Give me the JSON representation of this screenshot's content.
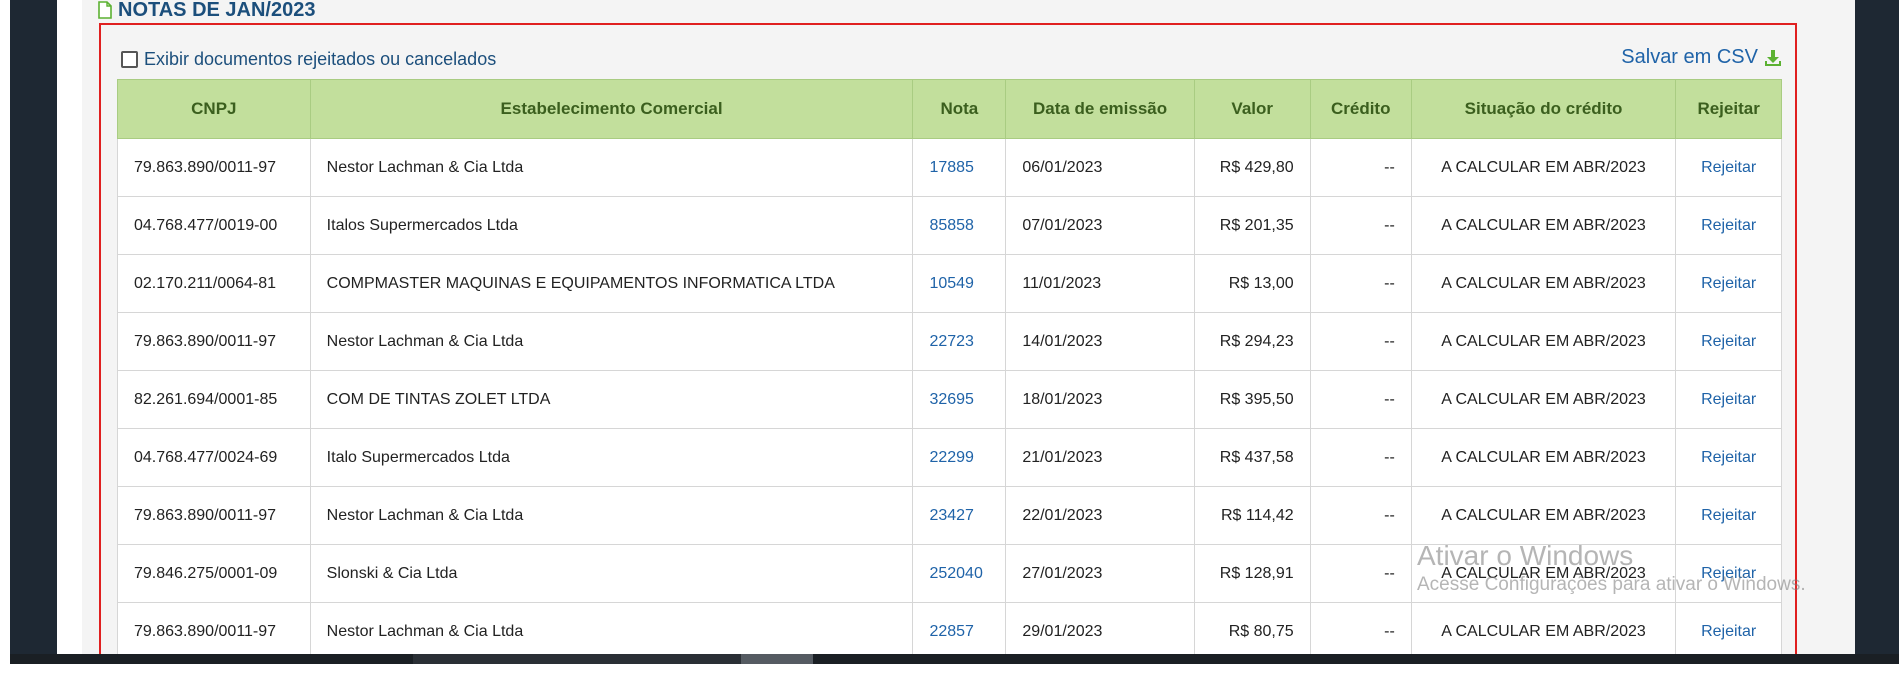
{
  "section": {
    "title": "NOTAS DE JAN/2023"
  },
  "toolbar": {
    "checkbox_label": "Exibir documentos rejeitados ou cancelados",
    "csv_label": "Salvar em CSV"
  },
  "table": {
    "headers": [
      "CNPJ",
      "Estabelecimento Comercial",
      "Nota",
      "Data de emissão",
      "Valor",
      "Crédito",
      "Situação do crédito",
      "Rejeitar"
    ],
    "rows": [
      {
        "cnpj": "79.863.890/0011-97",
        "estab": "Nestor Lachman & Cia Ltda",
        "nota": "17885",
        "data": "06/01/2023",
        "valor": "R$ 429,80",
        "credito": "--",
        "situacao": "A CALCULAR EM ABR/2023",
        "rejeitar": "Rejeitar"
      },
      {
        "cnpj": "04.768.477/0019-00",
        "estab": "Italos Supermercados Ltda",
        "nota": "85858",
        "data": "07/01/2023",
        "valor": "R$ 201,35",
        "credito": "--",
        "situacao": "A CALCULAR EM ABR/2023",
        "rejeitar": "Rejeitar"
      },
      {
        "cnpj": "02.170.211/0064-81",
        "estab": "COMPMASTER MAQUINAS E EQUIPAMENTOS INFORMATICA LTDA",
        "nota": "10549",
        "data": "11/01/2023",
        "valor": "R$ 13,00",
        "credito": "--",
        "situacao": "A CALCULAR EM ABR/2023",
        "rejeitar": "Rejeitar"
      },
      {
        "cnpj": "79.863.890/0011-97",
        "estab": "Nestor Lachman & Cia Ltda",
        "nota": "22723",
        "data": "14/01/2023",
        "valor": "R$ 294,23",
        "credito": "--",
        "situacao": "A CALCULAR EM ABR/2023",
        "rejeitar": "Rejeitar"
      },
      {
        "cnpj": "82.261.694/0001-85",
        "estab": "COM DE TINTAS ZOLET LTDA",
        "nota": "32695",
        "data": "18/01/2023",
        "valor": "R$ 395,50",
        "credito": "--",
        "situacao": "A CALCULAR EM ABR/2023",
        "rejeitar": "Rejeitar"
      },
      {
        "cnpj": "04.768.477/0024-69",
        "estab": "Italo Supermercados Ltda",
        "nota": "22299",
        "data": "21/01/2023",
        "valor": "R$ 437,58",
        "credito": "--",
        "situacao": "A CALCULAR EM ABR/2023",
        "rejeitar": "Rejeitar"
      },
      {
        "cnpj": "79.863.890/0011-97",
        "estab": "Nestor Lachman & Cia Ltda",
        "nota": "23427",
        "data": "22/01/2023",
        "valor": "R$ 114,42",
        "credito": "--",
        "situacao": "A CALCULAR EM ABR/2023",
        "rejeitar": "Rejeitar"
      },
      {
        "cnpj": "79.846.275/0001-09",
        "estab": "Slonski & Cia Ltda",
        "nota": "252040",
        "data": "27/01/2023",
        "valor": "R$ 128,91",
        "credito": "--",
        "situacao": "A CALCULAR EM ABR/2023",
        "rejeitar": "Rejeitar"
      },
      {
        "cnpj": "79.863.890/0011-97",
        "estab": "Nestor Lachman & Cia Ltda",
        "nota": "22857",
        "data": "29/01/2023",
        "valor": "R$ 80,75",
        "credito": "--",
        "situacao": "A CALCULAR EM ABR/2023",
        "rejeitar": "Rejeitar"
      }
    ]
  },
  "watermark": {
    "line1": "Ativar o Windows",
    "line2": "Acesse Configurações para ativar o Windows."
  },
  "colors": {
    "header_bg": "#c2df9c",
    "header_text": "#3b5f1e",
    "link": "#1f63a8",
    "title": "#1c4f7c",
    "frame": "#e02020",
    "csv_icon": "#5bb131"
  },
  "icons": {
    "title_icon": "document-icon",
    "csv_icon": "download-icon",
    "checkbox": "checkbox-unchecked"
  }
}
